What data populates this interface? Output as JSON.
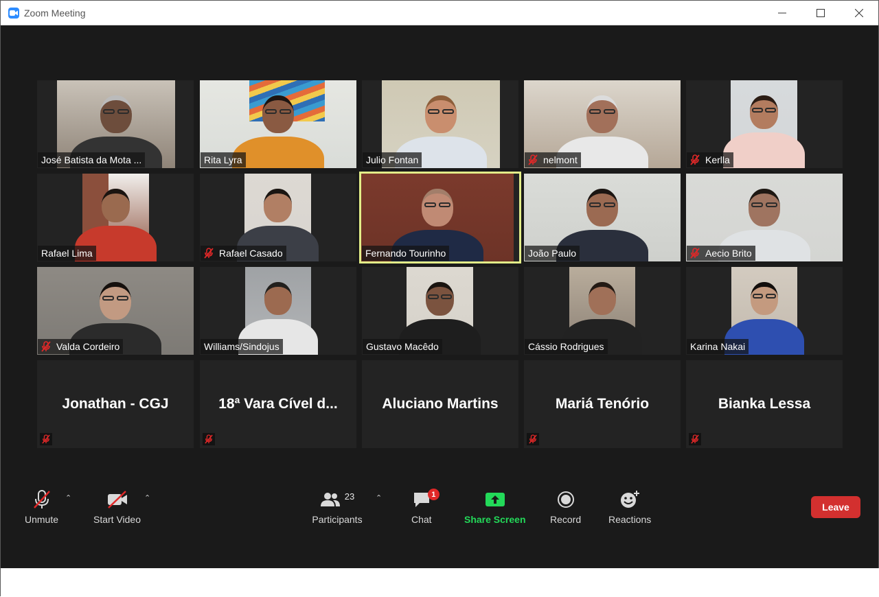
{
  "window": {
    "title": "Zoom Meeting",
    "controls": [
      "minimize-icon",
      "maximize-icon",
      "close-icon"
    ]
  },
  "participants_grid": [
    {
      "name": "José Batista da Mota ...",
      "muted": false,
      "video": true
    },
    {
      "name": "Rita Lyra",
      "muted": false,
      "video": true
    },
    {
      "name": "Julio Fontan",
      "muted": false,
      "video": true
    },
    {
      "name": "nelmont",
      "muted": true,
      "video": true
    },
    {
      "name": "Kerlla",
      "muted": true,
      "video": true
    },
    {
      "name": "Rafael Lima",
      "muted": false,
      "video": true
    },
    {
      "name": "Rafael Casado",
      "muted": true,
      "video": true
    },
    {
      "name": "Fernando Tourinho",
      "muted": false,
      "video": true,
      "active_speaker": true
    },
    {
      "name": "João Paulo",
      "muted": false,
      "video": true
    },
    {
      "name": "Aecio Brito",
      "muted": true,
      "video": true
    },
    {
      "name": "Valda Cordeiro",
      "muted": true,
      "video": true
    },
    {
      "name": "Williams/Sindojus",
      "muted": false,
      "video": true
    },
    {
      "name": "Gustavo Macêdo",
      "muted": false,
      "video": true
    },
    {
      "name": "Cássio Rodrigues",
      "muted": false,
      "video": true
    },
    {
      "name": "Karina Nakai",
      "muted": false,
      "video": true
    },
    {
      "name": "Jonathan - CGJ",
      "muted": true,
      "video": false
    },
    {
      "name": "18ª Vara Cível d...",
      "muted": true,
      "video": false
    },
    {
      "name": "Aluciano Martins",
      "muted": false,
      "video": false
    },
    {
      "name": "Mariá Tenório",
      "muted": true,
      "video": false
    },
    {
      "name": "Bianka Lessa",
      "muted": true,
      "video": false
    }
  ],
  "toolbar": {
    "unmute_label": "Unmute",
    "start_video_label": "Start Video",
    "participants_label": "Participants",
    "participants_count": "23",
    "chat_label": "Chat",
    "chat_badge": "1",
    "share_screen_label": "Share Screen",
    "record_label": "Record",
    "reactions_label": "Reactions",
    "leave_label": "Leave"
  },
  "colors": {
    "active_speaker_border": "#e3ee88",
    "share_screen": "#23d959",
    "leave_button": "#d3302f",
    "muted_icon": "#e02828",
    "app_accent": "#2d8cff"
  }
}
